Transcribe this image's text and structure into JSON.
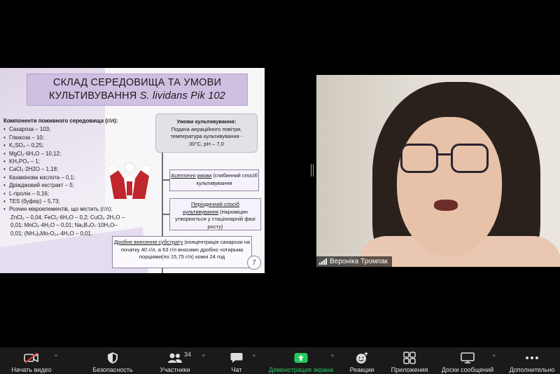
{
  "slide": {
    "title_line1": "СКЛАД СЕРЕДОВИЩА ТА УМОВИ",
    "title_line2_prefix": "КУЛЬТИВУВАННЯ ",
    "title_line2_italic": "S. lividans Pik 102",
    "components_header": "Компоненти поживного середовища (г/л):",
    "components": [
      "Сахароза – 103;",
      "Глюкоза – 10;",
      "K₂SO₄ – 0,25;",
      "MgCl₂·6H₂O – 10,12;",
      "KH₂PO₄ – 1;",
      "CaCl₂·2H2O – 1,18;",
      "Казамінова кислота – 0,1;",
      "Дріжджовий екстракт – 5;",
      "L-пролін – 0,16;",
      "TES (буфер) – 5,73;",
      "Розчин мікроелементів, що містить (г/л):"
    ],
    "trace_lines": [
      "ZnCl₂ – 0,04; FeCl₂·6H₂O – 0,2; CuCl₂·2H₂O –",
      "0,01;  MnCl₂·4H₂O  –  0,01;  Na₂B₄O₇·10H₂O–",
      "0,01; (NH₄)₆Mo₇O₂₄·4H₂O – 0,01."
    ],
    "conditions_title": "Умови культивування:",
    "conditions_text1": "Подача аераційного повітря,",
    "conditions_text2": "температура культивування -",
    "conditions_text3": "30°C, pH – 7,0",
    "box1_u": "Асептичні умови",
    "box1_rest": " (глибинний спосіб культивування",
    "box2_u1": "Періодичний спосіб",
    "box2_u2": "культивування",
    "box2_rest": " (пікроміцин утворюється у стаціонарній фазі росту)",
    "box3_u": "Дробне внесення субстрату",
    "box3_rest": " (концентрація сахарози на початку 40 г/л, а 63 г/л вносимо дробно чотирьма порціями(по 15,75 г/л) кожні 24 год",
    "page_number": "7"
  },
  "participant": {
    "name": "Вероніка Тромпак"
  },
  "toolbar": {
    "items": [
      {
        "label": "Начать видео",
        "icon": "video-off-icon"
      },
      {
        "label": "Безопасность",
        "icon": "shield-icon"
      },
      {
        "label": "Участники",
        "icon": "participants-icon",
        "count": "34"
      },
      {
        "label": "Чат",
        "icon": "chat-icon"
      },
      {
        "label": "Демонстрация экрана",
        "icon": "share-screen-icon"
      },
      {
        "label": "Реакции",
        "icon": "reactions-icon"
      },
      {
        "label": "Приложения",
        "icon": "apps-icon"
      },
      {
        "label": "Доски сообщений",
        "icon": "whiteboard-icon"
      },
      {
        "label": "Дополнительно",
        "icon": "more-icon"
      }
    ],
    "accent_green": "#24c85d"
  }
}
